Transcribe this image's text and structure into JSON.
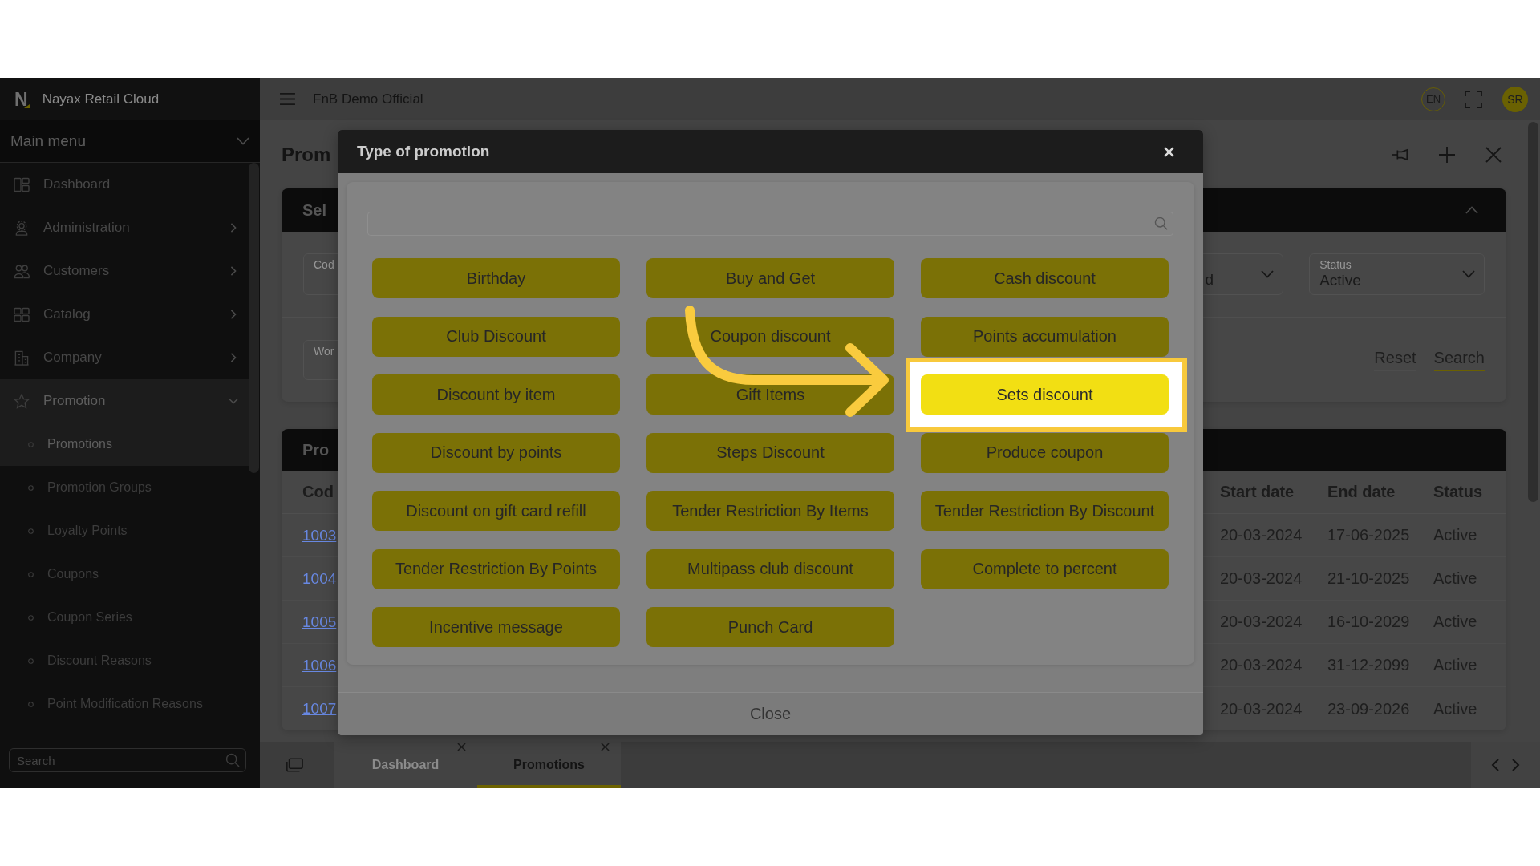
{
  "sidebar": {
    "logo": "N",
    "brand": "Nayax Retail Cloud",
    "menu_title": "Main menu",
    "items": [
      {
        "label": "Dashboard",
        "selected": false
      },
      {
        "label": "Administration",
        "expanded": false,
        "selected": false
      },
      {
        "label": "Customers",
        "expanded": false,
        "selected": false
      },
      {
        "label": "Catalog",
        "expanded": false,
        "selected": false
      },
      {
        "label": "Company",
        "expanded": false,
        "selected": false
      },
      {
        "label": "Promotion",
        "expanded": true,
        "selected": true,
        "children": [
          {
            "label": "Promotions",
            "selected": true
          },
          {
            "label": "Promotion Groups",
            "selected": false
          },
          {
            "label": "Loyalty Points",
            "selected": false
          },
          {
            "label": "Coupons",
            "selected": false
          },
          {
            "label": "Coupon Series",
            "selected": false
          },
          {
            "label": "Discount Reasons",
            "selected": false
          },
          {
            "label": "Point Modification Reasons",
            "selected": false
          }
        ]
      }
    ],
    "search": {
      "placeholder": "Search"
    }
  },
  "top_bar": {
    "title": "FnB Demo Official",
    "language": "EN",
    "avatar": "SR"
  },
  "page": {
    "title": "Prom",
    "filter_card": {
      "title": "Sel",
      "field_rows": [
        [
          {
            "label": "Cod",
            "kind": "text"
          },
          {
            "value": "d",
            "kind": "select"
          },
          {
            "label": "Status",
            "value": "Active",
            "kind": "select"
          }
        ],
        [
          {
            "label": "Wor",
            "kind": "text"
          }
        ]
      ],
      "buttons": [
        {
          "label": "Reset",
          "kind": "secondary"
        },
        {
          "label": "Search",
          "kind": "primary"
        }
      ]
    },
    "table_card": {
      "title": "Pro",
      "columns": [
        "Cod",
        "Start date",
        "End date",
        "Status"
      ],
      "rows": [
        [
          "1003",
          "20-03-2024",
          "17-06-2025",
          "Active"
        ],
        [
          "1004",
          "20-03-2024",
          "21-10-2025",
          "Active"
        ],
        [
          "1005",
          "20-03-2024",
          "16-10-2029",
          "Active"
        ],
        [
          "1006",
          "20-03-2024",
          "31-12-2099",
          "Active"
        ],
        [
          "1007",
          "20-03-2024",
          "23-09-2026",
          "Active"
        ]
      ]
    }
  },
  "dialog": {
    "title": "Type of promotion",
    "options": [
      {
        "label": "Birthday",
        "selected": false
      },
      {
        "label": "Buy and Get",
        "selected": false
      },
      {
        "label": "Cash discount",
        "selected": false
      },
      {
        "label": "Club Discount",
        "selected": false
      },
      {
        "label": "Coupon discount",
        "selected": false
      },
      {
        "label": "Points accumulation",
        "selected": false
      },
      {
        "label": "Discount by item",
        "selected": false
      },
      {
        "label": "Gift Items",
        "selected": false
      },
      {
        "label": "Sets discount",
        "selected": true
      },
      {
        "label": "Discount by points",
        "selected": false
      },
      {
        "label": "Steps Discount",
        "selected": false
      },
      {
        "label": "Produce coupon",
        "selected": false
      },
      {
        "label": "Discount on gift card refill",
        "selected": false
      },
      {
        "label": "Tender Restriction By Items",
        "selected": false
      },
      {
        "label": "Tender Restriction By Discount",
        "selected": false
      },
      {
        "label": "Tender Restriction By Points",
        "selected": false
      },
      {
        "label": "Multipass club discount",
        "selected": false
      },
      {
        "label": "Complete to percent",
        "selected": false
      },
      {
        "label": "Incentive message",
        "selected": false
      },
      {
        "label": "Punch Card",
        "selected": false
      }
    ],
    "close_button": "Close"
  },
  "tab_bar": {
    "tabs": [
      {
        "label": "Dashboard",
        "selected": false
      },
      {
        "label": "Promotions",
        "selected": true
      }
    ]
  }
}
